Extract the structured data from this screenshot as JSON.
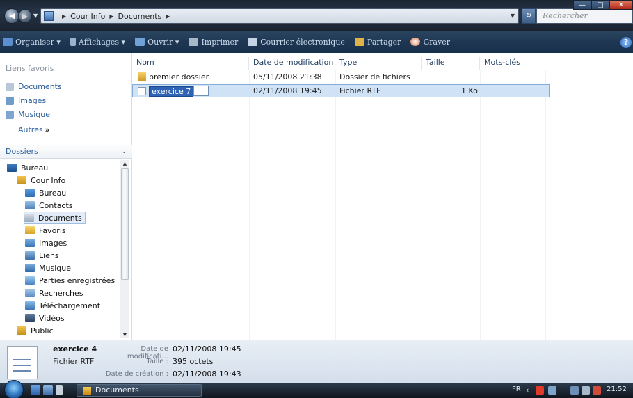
{
  "address": {
    "crumbs": [
      "Cour Info",
      "Documents"
    ],
    "search_placeholder": "Rechercher"
  },
  "window_controls": {
    "minimize": "—",
    "maximize": "□",
    "close": "✕"
  },
  "toolbar": {
    "organize": "Organiser",
    "views": "Affichages",
    "open": "Ouvrir",
    "print": "Imprimer",
    "email": "Courrier électronique",
    "share": "Partager",
    "burn": "Graver",
    "help": "?"
  },
  "favorites": {
    "title": "Liens favoris",
    "items": [
      "Documents",
      "Images",
      "Musique"
    ],
    "more": "Autres",
    "more_glyph": "»"
  },
  "folders": {
    "title": "Dossiers",
    "tree": [
      "Bureau",
      "Cour Info",
      "Bureau",
      "Contacts",
      "Documents",
      "Favoris",
      "Images",
      "Liens",
      "Musique",
      "Parties enregistrées",
      "Recherches",
      "Téléchargement",
      "Vidéos",
      "Public"
    ]
  },
  "columns": [
    "Nom",
    "Date de modification",
    "Type",
    "Taille",
    "Mots-clés"
  ],
  "files": [
    {
      "name": "premier dossier",
      "modified": "05/11/2008 21:38",
      "type": "Dossier de fichiers",
      "size": ""
    },
    {
      "name": "exercice 7",
      "modified": "02/11/2008 19:45",
      "type": "Fichier RTF",
      "size": "1 Ko"
    }
  ],
  "details": {
    "name": "exercice 4",
    "type": "Fichier RTF",
    "modified_label": "Date de modificati...",
    "modified_value": "02/11/2008 19:45",
    "size_label": "Taille :",
    "size_value": "395 octets",
    "created_label": "Date de création :",
    "created_value": "02/11/2008 19:43"
  },
  "taskbar": {
    "window": "Documents",
    "lang": "FR",
    "clock": "21:52"
  }
}
